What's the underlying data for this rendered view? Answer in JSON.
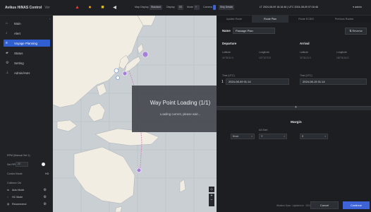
{
  "app": {
    "title": "Avikus HiNAS Control",
    "version": "Ver"
  },
  "topbar": {
    "display_label": "Map Display",
    "display_chip": "Standard",
    "display2": "Display",
    "disp_val": "03",
    "mode": "Mode",
    "camera": "Camera",
    "cam_chip": "Ship Details",
    "datetime": "LT 2024-08-09 16:16:46 | UTC 2024-08-09 07:16:46",
    "user": "admin"
  },
  "sidebar": {
    "items": [
      {
        "icon": "home-icon",
        "label": "Main"
      },
      {
        "icon": "bell-icon",
        "label": "Alert"
      },
      {
        "icon": "route-icon",
        "label": "Voyage Planning"
      },
      {
        "icon": "status-icon",
        "label": "Status"
      },
      {
        "icon": "gear-icon",
        "label": "Setting"
      },
      {
        "icon": "user-icon",
        "label": "Admin/HoH"
      }
    ],
    "rpm_title": "RPM (Manual Set 1)",
    "rpm_label": "Set RPM",
    "rpm_value": "20",
    "control_mode": "Control Mode",
    "control_val": "HG",
    "colregs": "Collision Ctrl",
    "modes": [
      {
        "label": "Auto Mode"
      },
      {
        "label": "HC Mode"
      },
      {
        "label": "Recommend"
      }
    ]
  },
  "overlay": {
    "title": "Way Point Loading (1/1)",
    "message": "Loading current, please wait..."
  },
  "panel": {
    "tabs": [
      "Update Route",
      "Route Plan",
      "Route ECDIS",
      "Previous Routes"
    ],
    "active_tab": 1,
    "name_label": "Name",
    "name_value": "Passage Plan",
    "reverse_label": "Reverse",
    "departure": "Departure",
    "arrival": "Arrival",
    "latitude": "Latitude",
    "longitude": "Longitude",
    "dep_lat": "34°35'41 N",
    "dep_lon": "137°10'70 E",
    "arr_lat": "33°36.24 S",
    "arr_lon": "150°00.64 E",
    "time_label": "Time (UTC)",
    "dep_time": "2024-08-09 01:14",
    "dep_index": "1",
    "arr_time": "2024-08-15 01:14",
    "margin_label": "Margin",
    "aa_label": "AA Start",
    "sel1": "Knot",
    "sel2": "Y",
    "sel3": "0",
    "status": "Weather Data · Updated on : 2024-08-09 08:52:46 UTC",
    "cancel": "Cancel",
    "confirm": "Continue"
  }
}
